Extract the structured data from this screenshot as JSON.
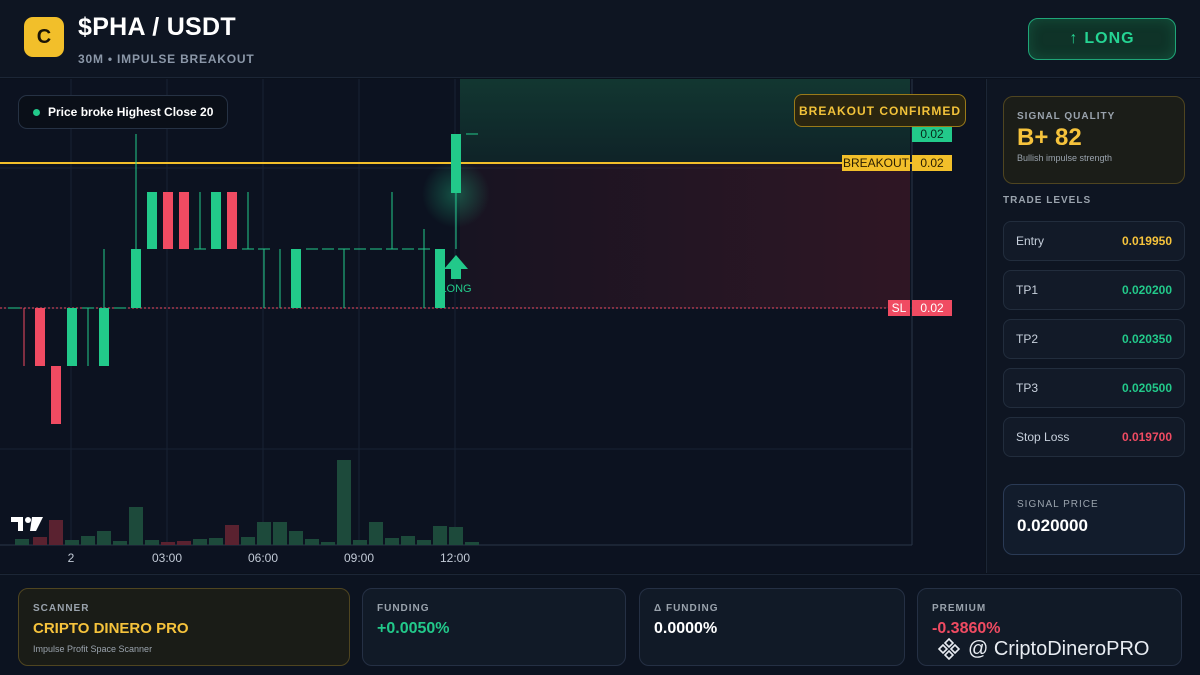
{
  "header": {
    "logo_letter": "C",
    "pair": "$PHA / USDT",
    "subtitle": "30M • IMPULSE BREAKOUT",
    "long_label": "LONG",
    "long_icon": "arrow-up-icon"
  },
  "chart": {
    "note": "Price broke Highest Close 20",
    "confirmed_label": "BREAKOUT CONFIRMED",
    "breakout_label": "BREAKOUT",
    "breakout_value": "0.02",
    "top_value": "0.02",
    "sl_label": "SL",
    "sl_value": "0.02",
    "signal_label": "LONG",
    "time_labels": [
      "2",
      "03:00",
      "06:00",
      "09:00",
      "12:00"
    ],
    "colors": {
      "up": "#22c98a",
      "down": "#f04b62",
      "breakout": "#f2bf2a",
      "sl": "#f04b62"
    }
  },
  "chart_data": {
    "type": "candlestick",
    "x": [
      "2",
      "03:00",
      "06:00",
      "09:00",
      "12:00"
    ],
    "levels": {
      "breakout": 0.02,
      "stop_loss": 0.02
    }
  },
  "panel": {
    "quality_label": "SIGNAL QUALITY",
    "quality_value": "B+ 82",
    "quality_desc": "Bullish impulse strength",
    "levels_title": "TRADE LEVELS",
    "levels": [
      {
        "name": "Entry",
        "value": "0.019950",
        "color": "#f6c33c"
      },
      {
        "name": "TP1",
        "value": "0.020200",
        "color": "#22c98a"
      },
      {
        "name": "TP2",
        "value": "0.020350",
        "color": "#22c98a"
      },
      {
        "name": "TP3",
        "value": "0.020500",
        "color": "#22c98a"
      },
      {
        "name": "Stop Loss",
        "value": "0.019700",
        "color": "#f04b62"
      }
    ],
    "signal_price_label": "SIGNAL PRICE",
    "signal_price": "0.020000"
  },
  "footer": {
    "scanner_label": "SCANNER",
    "scanner_name": "CRIPTO DINERO PRO",
    "scanner_desc": "Impulse Profit Space Scanner",
    "funding_label": "FUNDING",
    "funding_value": "+0.0050%",
    "dfunding_label": "Δ FUNDING",
    "dfunding_value": "0.0000%",
    "premium_label": "PREMIUM",
    "premium_value": "-0.3860%",
    "watermark": "@ CriptoDineroPRO"
  }
}
